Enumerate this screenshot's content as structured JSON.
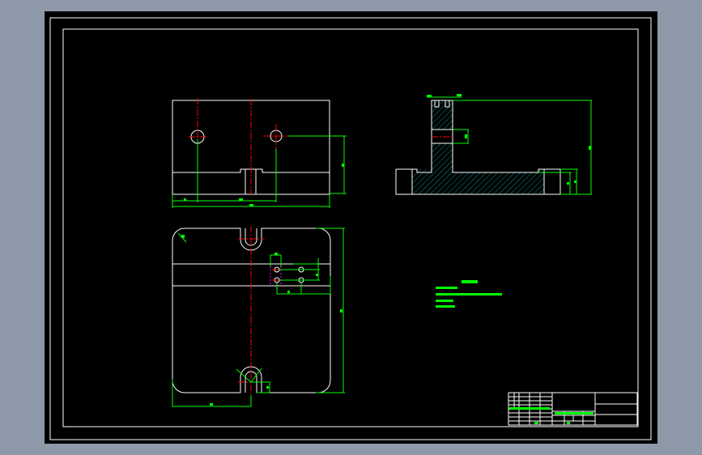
{
  "colors": {
    "window_background": "#8d99a8",
    "canvas_background": "#000000",
    "outline": "#ffffff",
    "dimension": "#00ff00",
    "centerline": "#ff0000",
    "hatch": "#00ffff",
    "hidden": "#ff00ff"
  }
}
